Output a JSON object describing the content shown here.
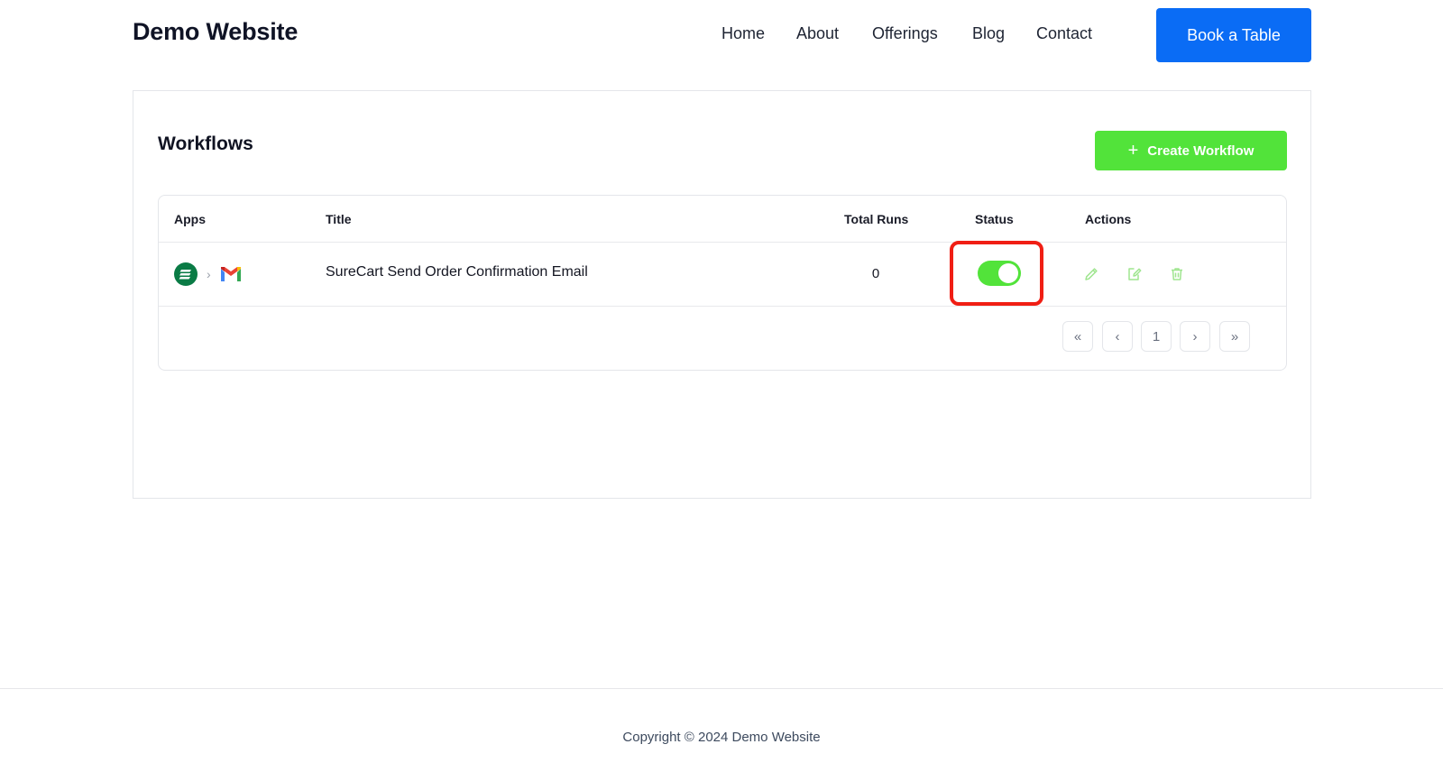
{
  "header": {
    "site_title": "Demo Website",
    "nav": [
      "Home",
      "About",
      "Offerings",
      "Blog",
      "Contact"
    ],
    "cta_label": "Book a Table"
  },
  "workflows": {
    "heading": "Workflows",
    "create_label": "Create Workflow",
    "columns": {
      "apps": "Apps",
      "title": "Title",
      "total_runs": "Total Runs",
      "status": "Status",
      "actions": "Actions"
    },
    "rows": [
      {
        "apps": [
          "surecart-icon",
          "gmail-icon"
        ],
        "title": "SureCart Send Order Confirmation Email",
        "total_runs": "0",
        "status_enabled": true
      }
    ],
    "pagination": {
      "current_page": "1"
    }
  },
  "colors": {
    "primary_blue": "#0a6cf5",
    "accent_green": "#52e33a",
    "highlight_red": "#f01e14"
  },
  "footer": {
    "copyright": "Copyright © 2024 Demo Website"
  }
}
